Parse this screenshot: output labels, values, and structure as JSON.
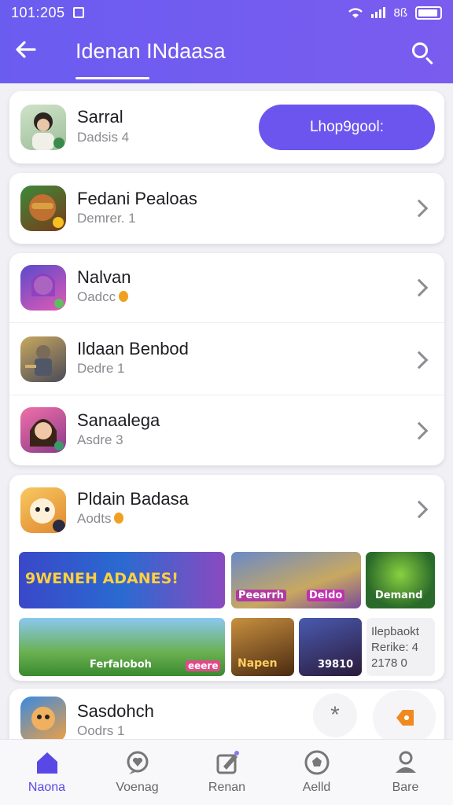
{
  "status_bar": {
    "time": "101:205",
    "network": "8ß"
  },
  "header": {
    "title": "Idenan INdaasa"
  },
  "top_card": {
    "name": "Sarral",
    "sub": "Dadsis 4",
    "button_label": "Lhop9gool:"
  },
  "single_card": {
    "name": "Fedani Pealoas",
    "sub": "Demrer. 1"
  },
  "group_card": {
    "items": [
      {
        "name": "Nalvan",
        "sub": "Oadcc"
      },
      {
        "name": "Ildaan Benbod",
        "sub": "Dedre 1"
      },
      {
        "name": "Sanaalega",
        "sub": "Asdre 3"
      }
    ]
  },
  "feature_card": {
    "name": "Pldain Badasa",
    "sub": "Aodts",
    "tiles_row1": [
      "9WENEH ADANES!",
      "Peearrh",
      "Deldo",
      "Demand"
    ],
    "tiles_row2": [
      "Ferfaloboh",
      "eeere",
      "Napen",
      "39810"
    ],
    "info_tile": {
      "line1": "Ilepbaokt",
      "line2": "Rerike: 4",
      "line3": "2178 0"
    }
  },
  "bottom_card": {
    "name": "Sasdohch",
    "sub": "Oodrs 1"
  },
  "tabs": [
    {
      "label": "Naona",
      "icon": "home-icon"
    },
    {
      "label": "Voenag",
      "icon": "chat-heart-icon"
    },
    {
      "label": "Renan",
      "icon": "edit-icon"
    },
    {
      "label": "Aelld",
      "icon": "soccer-ball-icon"
    },
    {
      "label": "Bare",
      "icon": "profile-icon"
    }
  ],
  "colors": {
    "accent": "#6c55ee",
    "header": "#6b5cf0",
    "active_tab": "#5a48e6"
  }
}
